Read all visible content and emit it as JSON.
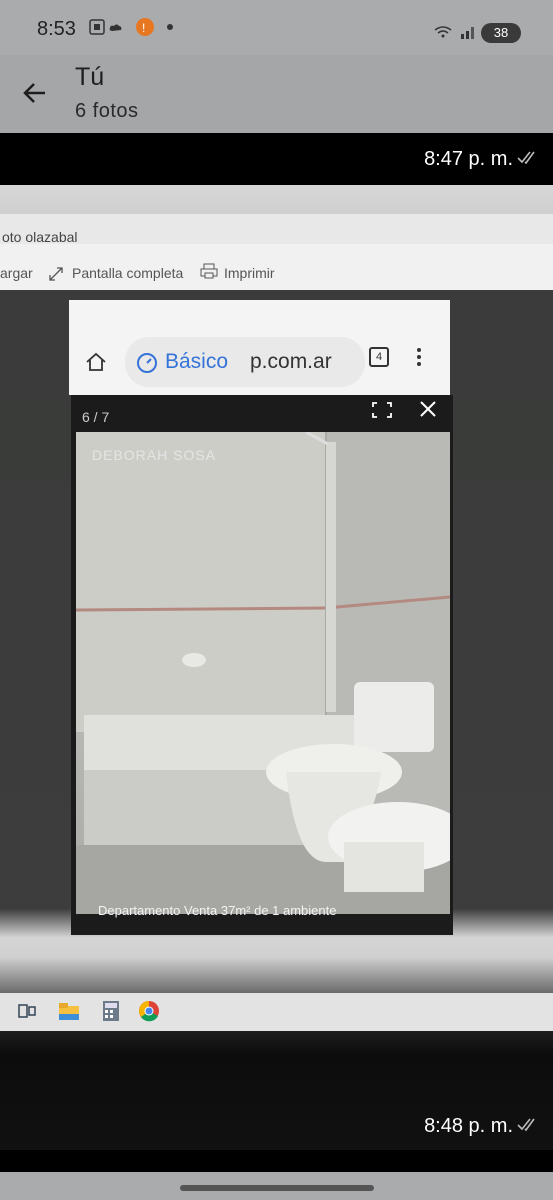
{
  "status_bar": {
    "time": "8:53",
    "battery": "38"
  },
  "header": {
    "title": "Tú",
    "subtitle": "6 fotos"
  },
  "messages": [
    {
      "time": "8:47 p. m."
    },
    {
      "time": "8:48 p. m."
    }
  ],
  "photo": {
    "tab_text": "oto olazabal",
    "toolbar": {
      "item1": "argar",
      "item2": "Pantalla completa",
      "item3": "Imprimir"
    },
    "browser": {
      "mode": "Básico",
      "url": "p.com.ar",
      "tab_count": "4"
    },
    "viewer": {
      "counter": "6 / 7",
      "watermark": "DEBORAH SOSA",
      "caption": "Departamento Venta 37m² de 1 ambiente"
    }
  }
}
